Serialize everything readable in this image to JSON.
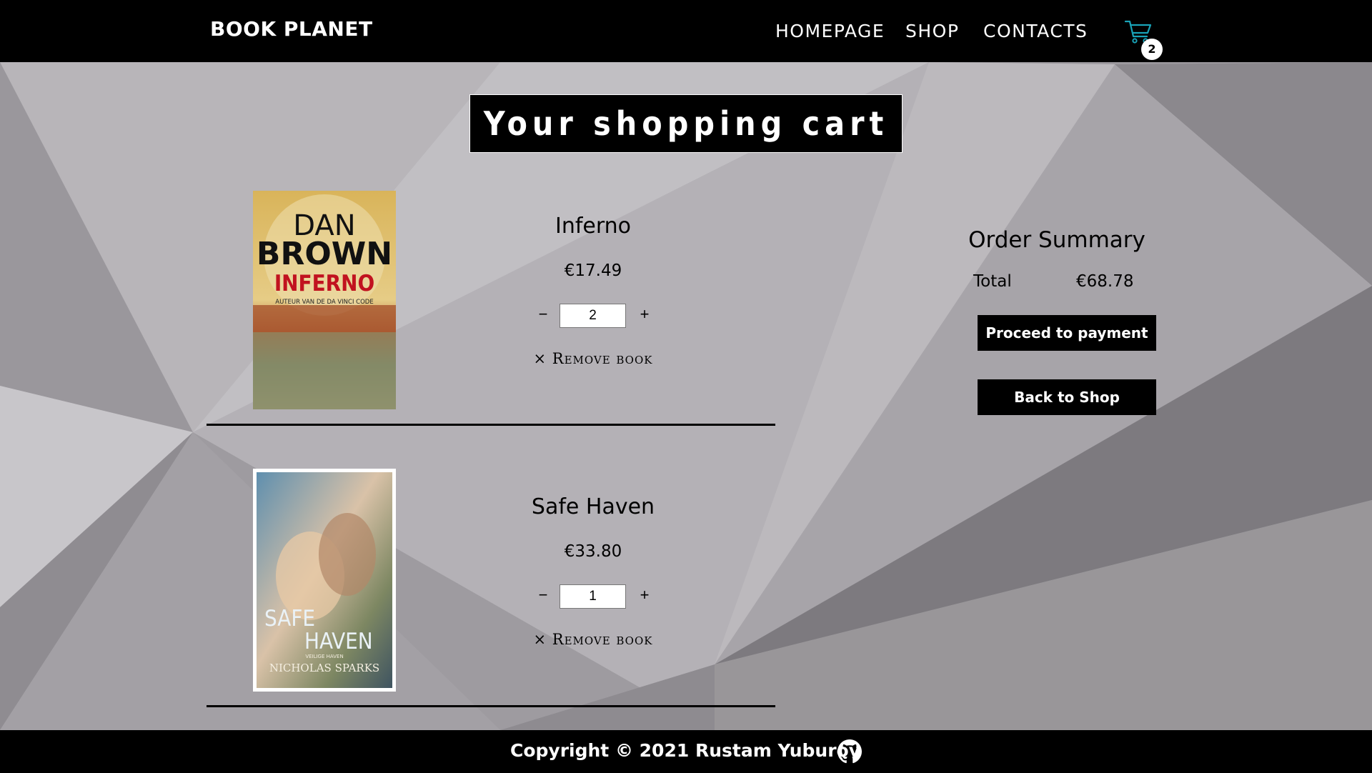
{
  "header": {
    "brand": "BOOK PLANET",
    "nav": {
      "homepage": "HOMEPAGE",
      "shop": "SHOP",
      "contacts": "CONTACTS"
    },
    "cart_count": "2",
    "cart_icon_color": "#19a3b8"
  },
  "page_title": "Your shopping cart",
  "cart": {
    "items": [
      {
        "title": "Inferno",
        "price": "€17.49",
        "quantity": "2",
        "minus": "−",
        "plus": "+",
        "remove": "× Remove book",
        "cover": {
          "author_line1": "DAN",
          "author_line2": "BROWN",
          "title": "INFERNO",
          "subtitle": "AUTEUR VAN DE DA VINCI CODE"
        }
      },
      {
        "title": "Safe Haven",
        "price": "€33.80",
        "quantity": "1",
        "minus": "−",
        "plus": "+",
        "remove": "× Remove book",
        "cover": {
          "title_line1": "SAFE",
          "title_line2": "HAVEN",
          "subtitle": "VEILIGE HAVEN",
          "author": "NICHOLAS SPARKS"
        }
      }
    ]
  },
  "summary": {
    "title": "Order Summary",
    "total_label": "Total",
    "total_value": "€68.78",
    "payment_button": "Proceed to payment",
    "back_button": "Back to Shop"
  },
  "footer": {
    "text": "Copyright © 2021 Rustam Yuburov"
  },
  "colors": {
    "bar": "#000000",
    "inferno_title": "#c1121f"
  }
}
